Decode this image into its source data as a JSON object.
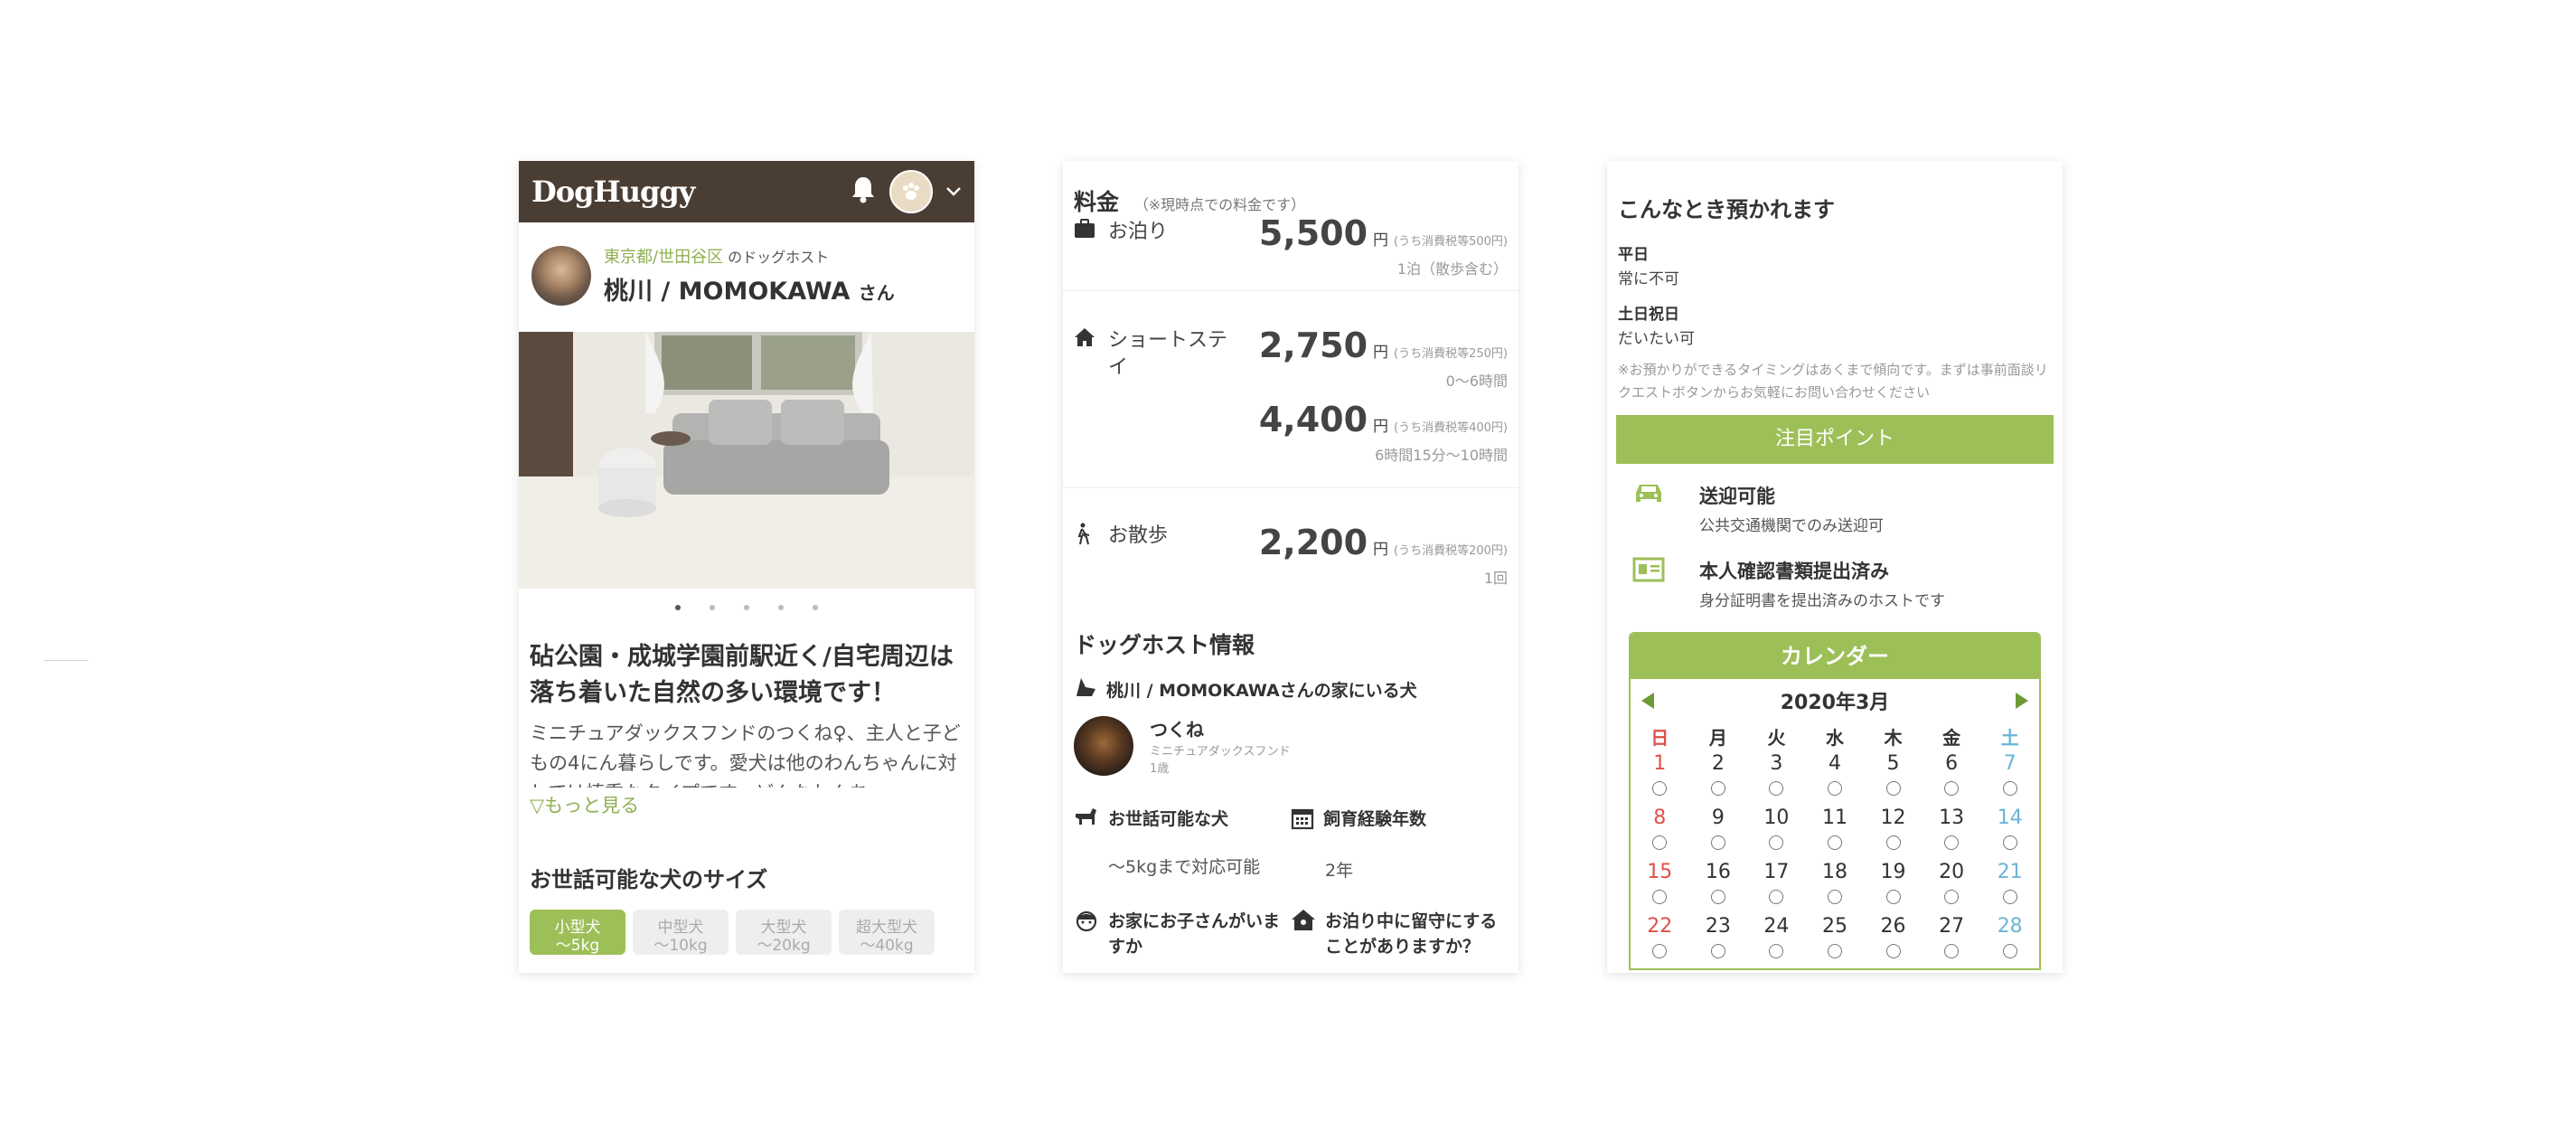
{
  "panel1": {
    "logo": "DogHuggy",
    "host": {
      "area": "東京都/世田谷区",
      "area_suffix": "のドッグホスト",
      "name": "桃川 / MOMOKAWA",
      "honorific": "さん"
    },
    "photo_dots": [
      true,
      false,
      false,
      false,
      false
    ],
    "title": "砧公園・成城学園前駅近く/自宅周辺は落ち着いた自然の多い環境です！",
    "description": "ミニチュアダックスフンドのつくね♀、主人と子どもの4にん暮らしです。愛犬は他のわんちゃんに対しては慎重なタイプです。どんなわんち",
    "more_link": "▽もっと見る",
    "size_section_title": "お世話可能な犬のサイズ",
    "sizes": [
      {
        "label": "小型犬",
        "sub": "〜5kg",
        "active": true
      },
      {
        "label": "中型犬",
        "sub": "〜10kg",
        "active": false
      },
      {
        "label": "大型犬",
        "sub": "〜20kg",
        "active": false
      },
      {
        "label": "超大型犬",
        "sub": "〜40kg",
        "active": false
      }
    ]
  },
  "panel2": {
    "price_title": "料金",
    "price_note": "（※現時点での料金です）",
    "prices": {
      "stay": {
        "label": "お泊り",
        "amount": "5,500",
        "yen": "円",
        "tax": "(うち消費税等500円)",
        "cond": "1泊（散歩含む）"
      },
      "short": {
        "label": "ショートステイ",
        "amount1": "2,750",
        "tax1": "(うち消費税等250円)",
        "cond1": "0〜6時間",
        "amount2": "4,400",
        "tax2": "(うち消費税等400円)",
        "cond2": "6時間15分〜10時間",
        "yen": "円"
      },
      "walk": {
        "label": "お散歩",
        "amount": "2,200",
        "yen": "円",
        "tax": "(うち消費税等200円)",
        "cond": "1回"
      }
    },
    "info_title": "ドッグホスト情報",
    "dogs_title": "桃川 / MOMOKAWAさんの家にいる犬",
    "dog": {
      "name": "つくね",
      "breed": "ミニチュアダックスフンド",
      "age": "1歳"
    },
    "can_care_title": "お世話可能な犬",
    "can_care_value": "〜5kgまで対応可能",
    "experience_title": "飼育経験年数",
    "experience_value": "2年",
    "children_title": "お家にお子さんがいますか",
    "away_title": "お泊り中に留守にすることがありますか？"
  },
  "panel3": {
    "when_title": "こんなとき預かれます",
    "weekday_label": "平日",
    "weekday_value": "常に不可",
    "holiday_label": "土日祝日",
    "holiday_value": "だいたい可",
    "note": "※お預かりができるタイミングはあくまで傾向です。まずは事前面談リクエストボタンからお気軽にお問い合わせください",
    "attention_label": "注目ポイント",
    "features": [
      {
        "title": "送迎可能",
        "sub": "公共交通機関でのみ送迎可"
      },
      {
        "title": "本人確認書類提出済み",
        "sub": "身分証明書を提出済みのホストです"
      }
    ],
    "calendar": {
      "title": "カレンダー",
      "month": "2020年3月",
      "weekdays": [
        "日",
        "月",
        "火",
        "水",
        "木",
        "金",
        "土"
      ],
      "weeks": [
        [
          "1",
          "2",
          "3",
          "4",
          "5",
          "6",
          "7"
        ],
        [
          "8",
          "9",
          "10",
          "11",
          "12",
          "13",
          "14"
        ],
        [
          "15",
          "16",
          "17",
          "18",
          "19",
          "20",
          "21"
        ],
        [
          "22",
          "23",
          "24",
          "25",
          "26",
          "27",
          "28"
        ]
      ],
      "availability_mark": "○"
    }
  },
  "colors": {
    "brand_green": "#9dbf58",
    "header_brown": "#4a3d34",
    "sunday_red": "#e0504a",
    "saturday_blue": "#6bb5d6"
  }
}
